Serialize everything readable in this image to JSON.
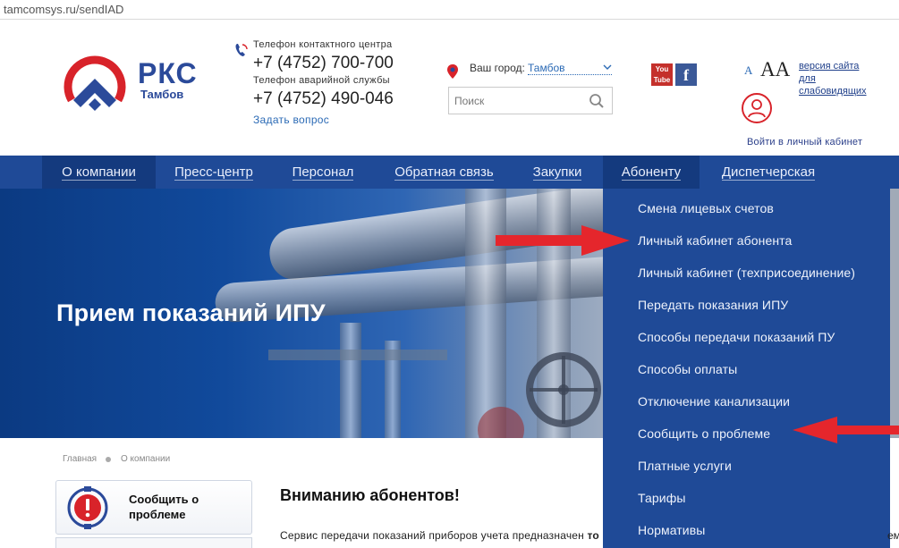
{
  "browser": {
    "url": "tamcomsys.ru/sendIAD"
  },
  "header": {
    "logo_title": "РКС",
    "logo_subtitle": "Тамбов",
    "contact_label": "Телефон контактного центра",
    "contact_phone": "+7 (4752) 700-700",
    "emergency_label": "Телефон аварийной службы",
    "emergency_phone": "+7 (4752) 490-046",
    "ask_link": "Задать вопрос",
    "city_label": "Ваш город:",
    "city_value": "Тамбов",
    "search_placeholder": "Поиск",
    "youtube_label": "You Tube",
    "facebook_label": "f",
    "font_small": "A",
    "font_big": "AA",
    "low_vision_link": "версия сайта для слабовидящих",
    "login_link": "Войти в личный кабинет"
  },
  "nav": {
    "items": [
      {
        "label": "О компании"
      },
      {
        "label": "Пресс-центр"
      },
      {
        "label": "Персонал"
      },
      {
        "label": "Обратная связь"
      },
      {
        "label": "Закупки"
      },
      {
        "label": "Абоненту"
      },
      {
        "label": "Диспетчерская"
      }
    ]
  },
  "hero": {
    "title": "Прием показаний ИПУ"
  },
  "dropdown": {
    "items": [
      {
        "label": "Смена лицевых счетов"
      },
      {
        "label": "Личный кабинет абонента"
      },
      {
        "label": "Личный кабинет (техприсоединение)"
      },
      {
        "label": "Передать показания ИПУ"
      },
      {
        "label": "Способы передачи показаний ПУ"
      },
      {
        "label": "Способы оплаты"
      },
      {
        "label": "Отключение канализации"
      },
      {
        "label": "Сообщить о проблеме"
      },
      {
        "label": "Платные услуги"
      },
      {
        "label": "Тарифы"
      },
      {
        "label": "Нормативы"
      }
    ]
  },
  "breadcrumb": {
    "home": "Главная",
    "current": "О компании"
  },
  "sidebar": {
    "report_problem": "Сообщить о проблеме"
  },
  "content": {
    "notice_title": "Вниманию абонентов!",
    "body_start": "Сервис передачи показаний приборов учета предназначен ",
    "body_bold": "то",
    "body_end": "ем,"
  },
  "colors": {
    "brand_blue": "#1f4a97",
    "accent_red": "#d8232a"
  }
}
